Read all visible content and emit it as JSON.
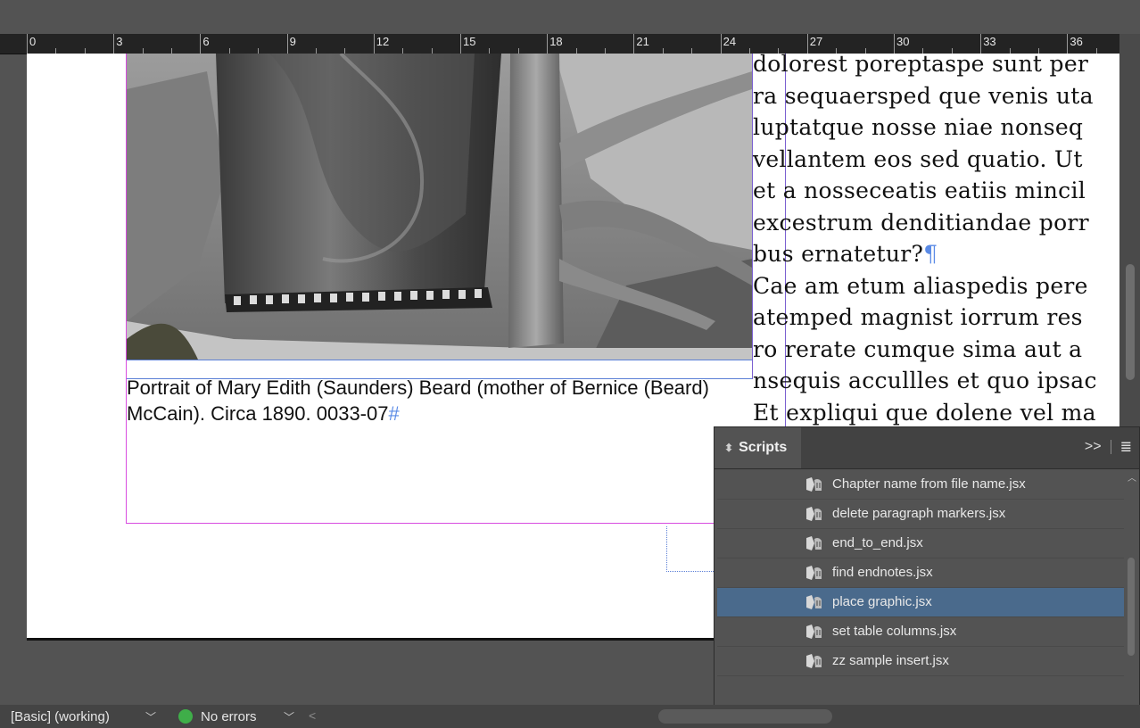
{
  "ruler": {
    "labels": [
      "0",
      "3",
      "6",
      "9",
      "12",
      "15",
      "18",
      "21",
      "24",
      "27",
      "30",
      "33",
      "36"
    ]
  },
  "document": {
    "caption_text": "Portrait of Mary Edith (Saunders) Beard (mother of Bernice (Beard) McCain). Circa 1890. 0033-07",
    "caption_end_marker": "#",
    "body_lines": [
      "dolorest poreptaspe sunt per",
      "ra sequaersped que venis uta",
      "luptatque nosse niae nonseq",
      "vellantem eos sed quatio. Ut",
      "et a nosseceatis eatiis mincil",
      "excestrum denditiandae porr",
      "bus ernatetur?",
      "Cae am etum aliaspedis pere",
      "atemped magnist iorrum res",
      "ro rerate cumque sima aut a",
      "nsequis accullles et quo ipsac",
      "Et expliqui que dolene vel ma"
    ],
    "pilcrow": "¶"
  },
  "scripts_panel": {
    "title": "Scripts",
    "items": [
      {
        "label": "Chapter name from file name.jsx",
        "selected": false
      },
      {
        "label": "delete paragraph markers.jsx",
        "selected": false
      },
      {
        "label": "end_to_end.jsx",
        "selected": false
      },
      {
        "label": "find endnotes.jsx",
        "selected": false
      },
      {
        "label": "place graphic.jsx",
        "selected": true
      },
      {
        "label": "set table columns.jsx",
        "selected": false
      },
      {
        "label": "zz sample insert.jsx",
        "selected": false
      }
    ],
    "expand_icon": "double-chevron-right-icon",
    "menu_icon": "hamburger-menu-icon"
  },
  "statusbar": {
    "preflight_profile": "[Basic] (working)",
    "error_status": "No errors",
    "status_color": "#3fae49"
  },
  "colors": {
    "selection": "#4a6a8c",
    "frame_magenta": "#d84ce0",
    "frame_blue": "#5b7fd6"
  }
}
